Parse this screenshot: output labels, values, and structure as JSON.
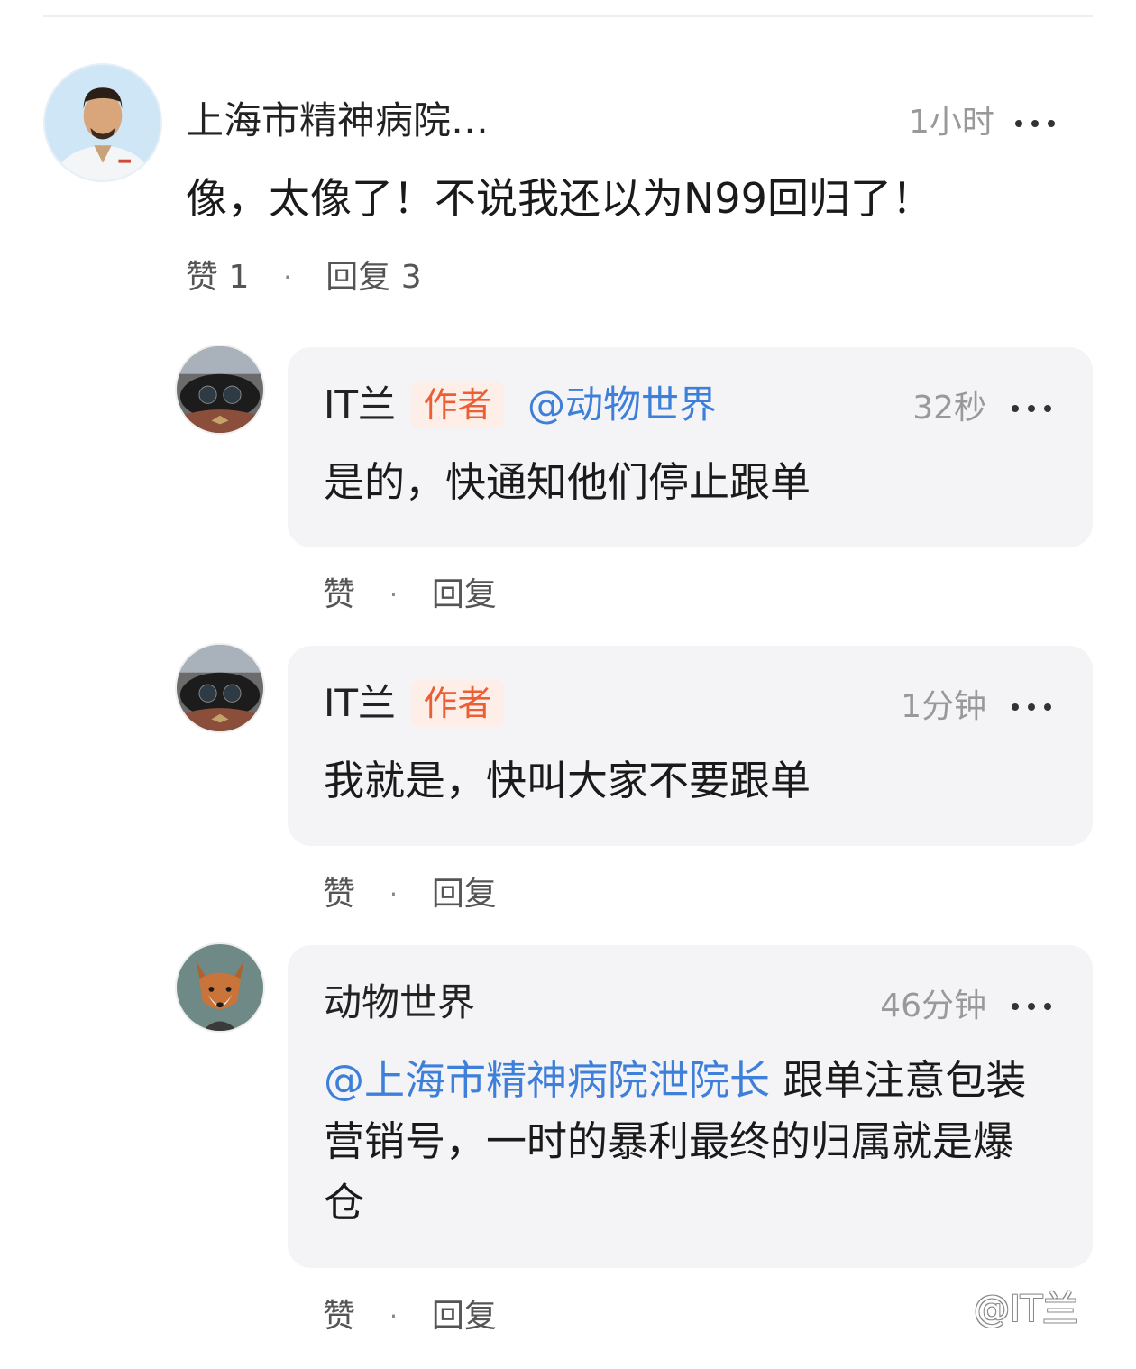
{
  "main_comment": {
    "username": "上海市精神病院…",
    "time": "1小时",
    "text": "像，太像了！不说我还以为N99回归了！",
    "like_label": "赞",
    "like_count": "1",
    "separator": "·",
    "reply_label": "回复",
    "reply_count": "3"
  },
  "replies": [
    {
      "username": "IT兰",
      "badge": "作者",
      "mention": "@动物世界",
      "time": "32秒",
      "text": "是的，快通知他们停止跟单",
      "like_label": "赞",
      "separator": "·",
      "reply_label": "回复"
    },
    {
      "username": "IT兰",
      "badge": "作者",
      "time": "1分钟",
      "text": "我就是，快叫大家不要跟单",
      "like_label": "赞",
      "separator": "·",
      "reply_label": "回复"
    },
    {
      "username": "动物世界",
      "time": "46分钟",
      "mention": "@上海市精神病院泄院长",
      "text": " 跟单注意包装营销号，一时的暴利最终的归属就是爆仓",
      "like_label": "赞",
      "separator": "·",
      "reply_label": "回复"
    }
  ],
  "watermark": "@IT兰",
  "icons": {
    "more": "more-horizontal-icon",
    "avatar_main": "doctor-avatar",
    "avatar_it": "car-dashboard-avatar",
    "avatar_fox": "fox-avatar"
  },
  "colors": {
    "mention": "#3d7fd9",
    "badge_text": "#ec5e35",
    "badge_bg": "#fdeee8",
    "bubble_bg": "#f4f4f6",
    "secondary_text": "#999999"
  }
}
